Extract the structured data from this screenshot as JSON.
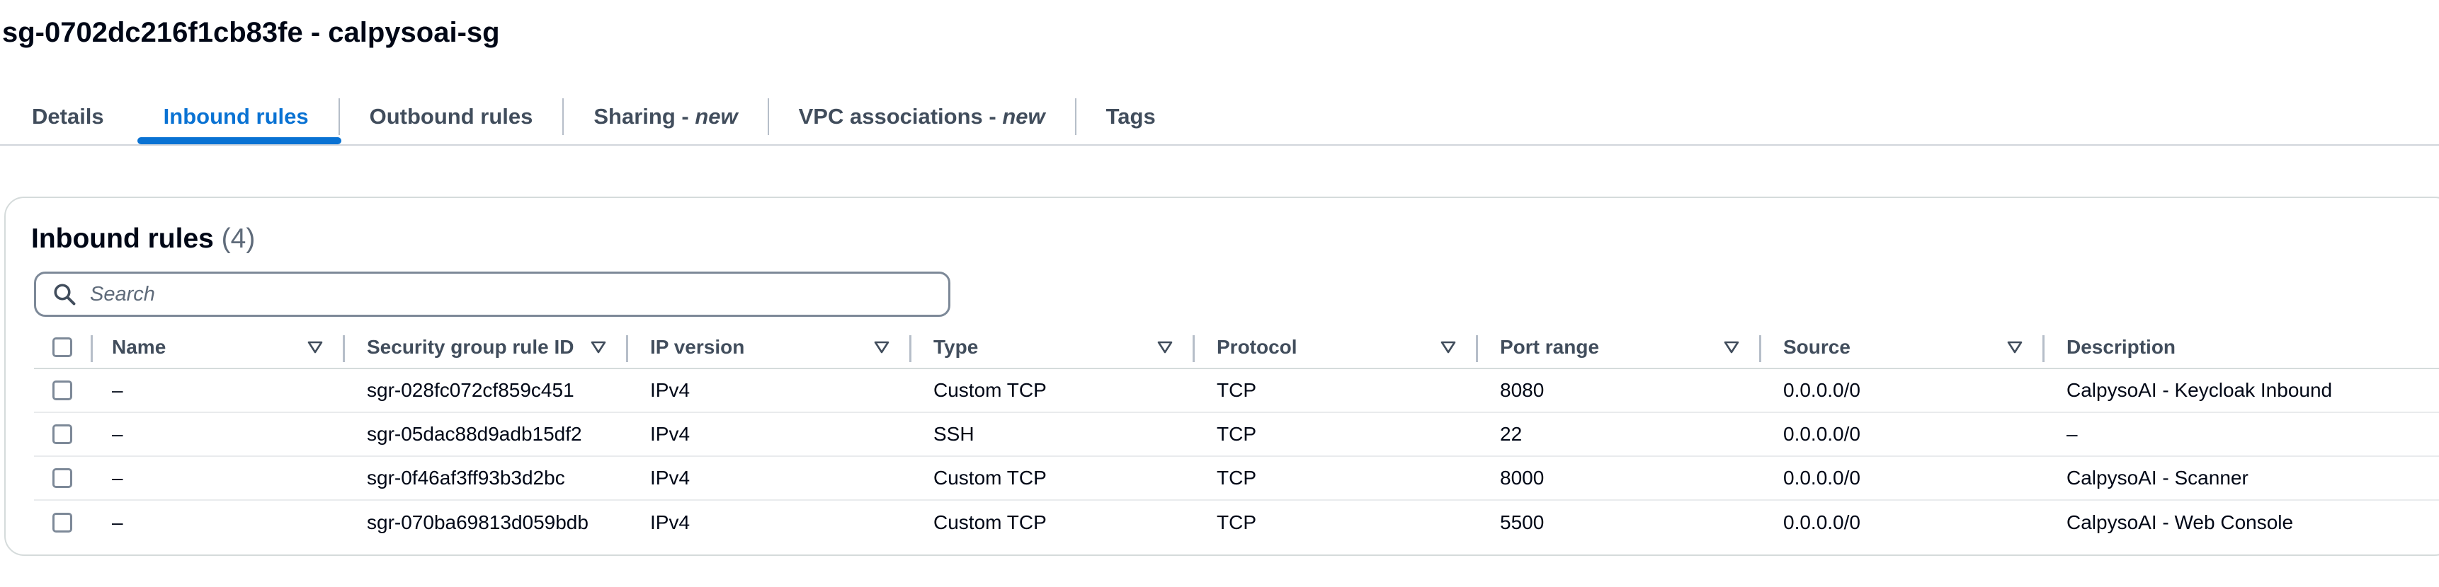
{
  "page": {
    "title": "sg-0702dc216f1cb83fe - calpysoai-sg"
  },
  "tabs": [
    {
      "label": "Details",
      "suffix": ""
    },
    {
      "label": "Inbound rules",
      "suffix": ""
    },
    {
      "label": "Outbound rules",
      "suffix": ""
    },
    {
      "label": "Sharing - ",
      "suffix": "new"
    },
    {
      "label": "VPC associations - ",
      "suffix": "new"
    },
    {
      "label": "Tags",
      "suffix": ""
    }
  ],
  "active_tab": "Inbound rules",
  "panel": {
    "title": "Inbound rules",
    "count": "(4)",
    "search_placeholder": "Search"
  },
  "table": {
    "columns": [
      "Name",
      "Security group rule ID",
      "IP version",
      "Type",
      "Protocol",
      "Port range",
      "Source",
      "Description"
    ],
    "rows": [
      [
        "–",
        "sgr-028fc072cf859c451",
        "IPv4",
        "Custom TCP",
        "TCP",
        "8080",
        "0.0.0.0/0",
        "CalpysoAI - Keycloak Inbound"
      ],
      [
        "–",
        "sgr-05dac88d9adb15df2",
        "IPv4",
        "SSH",
        "TCP",
        "22",
        "0.0.0.0/0",
        "–"
      ],
      [
        "–",
        "sgr-0f46af3ff93b3d2bc",
        "IPv4",
        "Custom TCP",
        "TCP",
        "8000",
        "0.0.0.0/0",
        "CalpysoAI - Scanner"
      ],
      [
        "–",
        "sgr-070ba69813d059bdb",
        "IPv4",
        "Custom TCP",
        "TCP",
        "5500",
        "0.0.0.0/0",
        "CalpysoAI - Web Console"
      ]
    ]
  },
  "colors": {
    "accent": "#0972d3",
    "text": "#000716",
    "muted": "#414d5c",
    "border": "#d5dbdb"
  }
}
